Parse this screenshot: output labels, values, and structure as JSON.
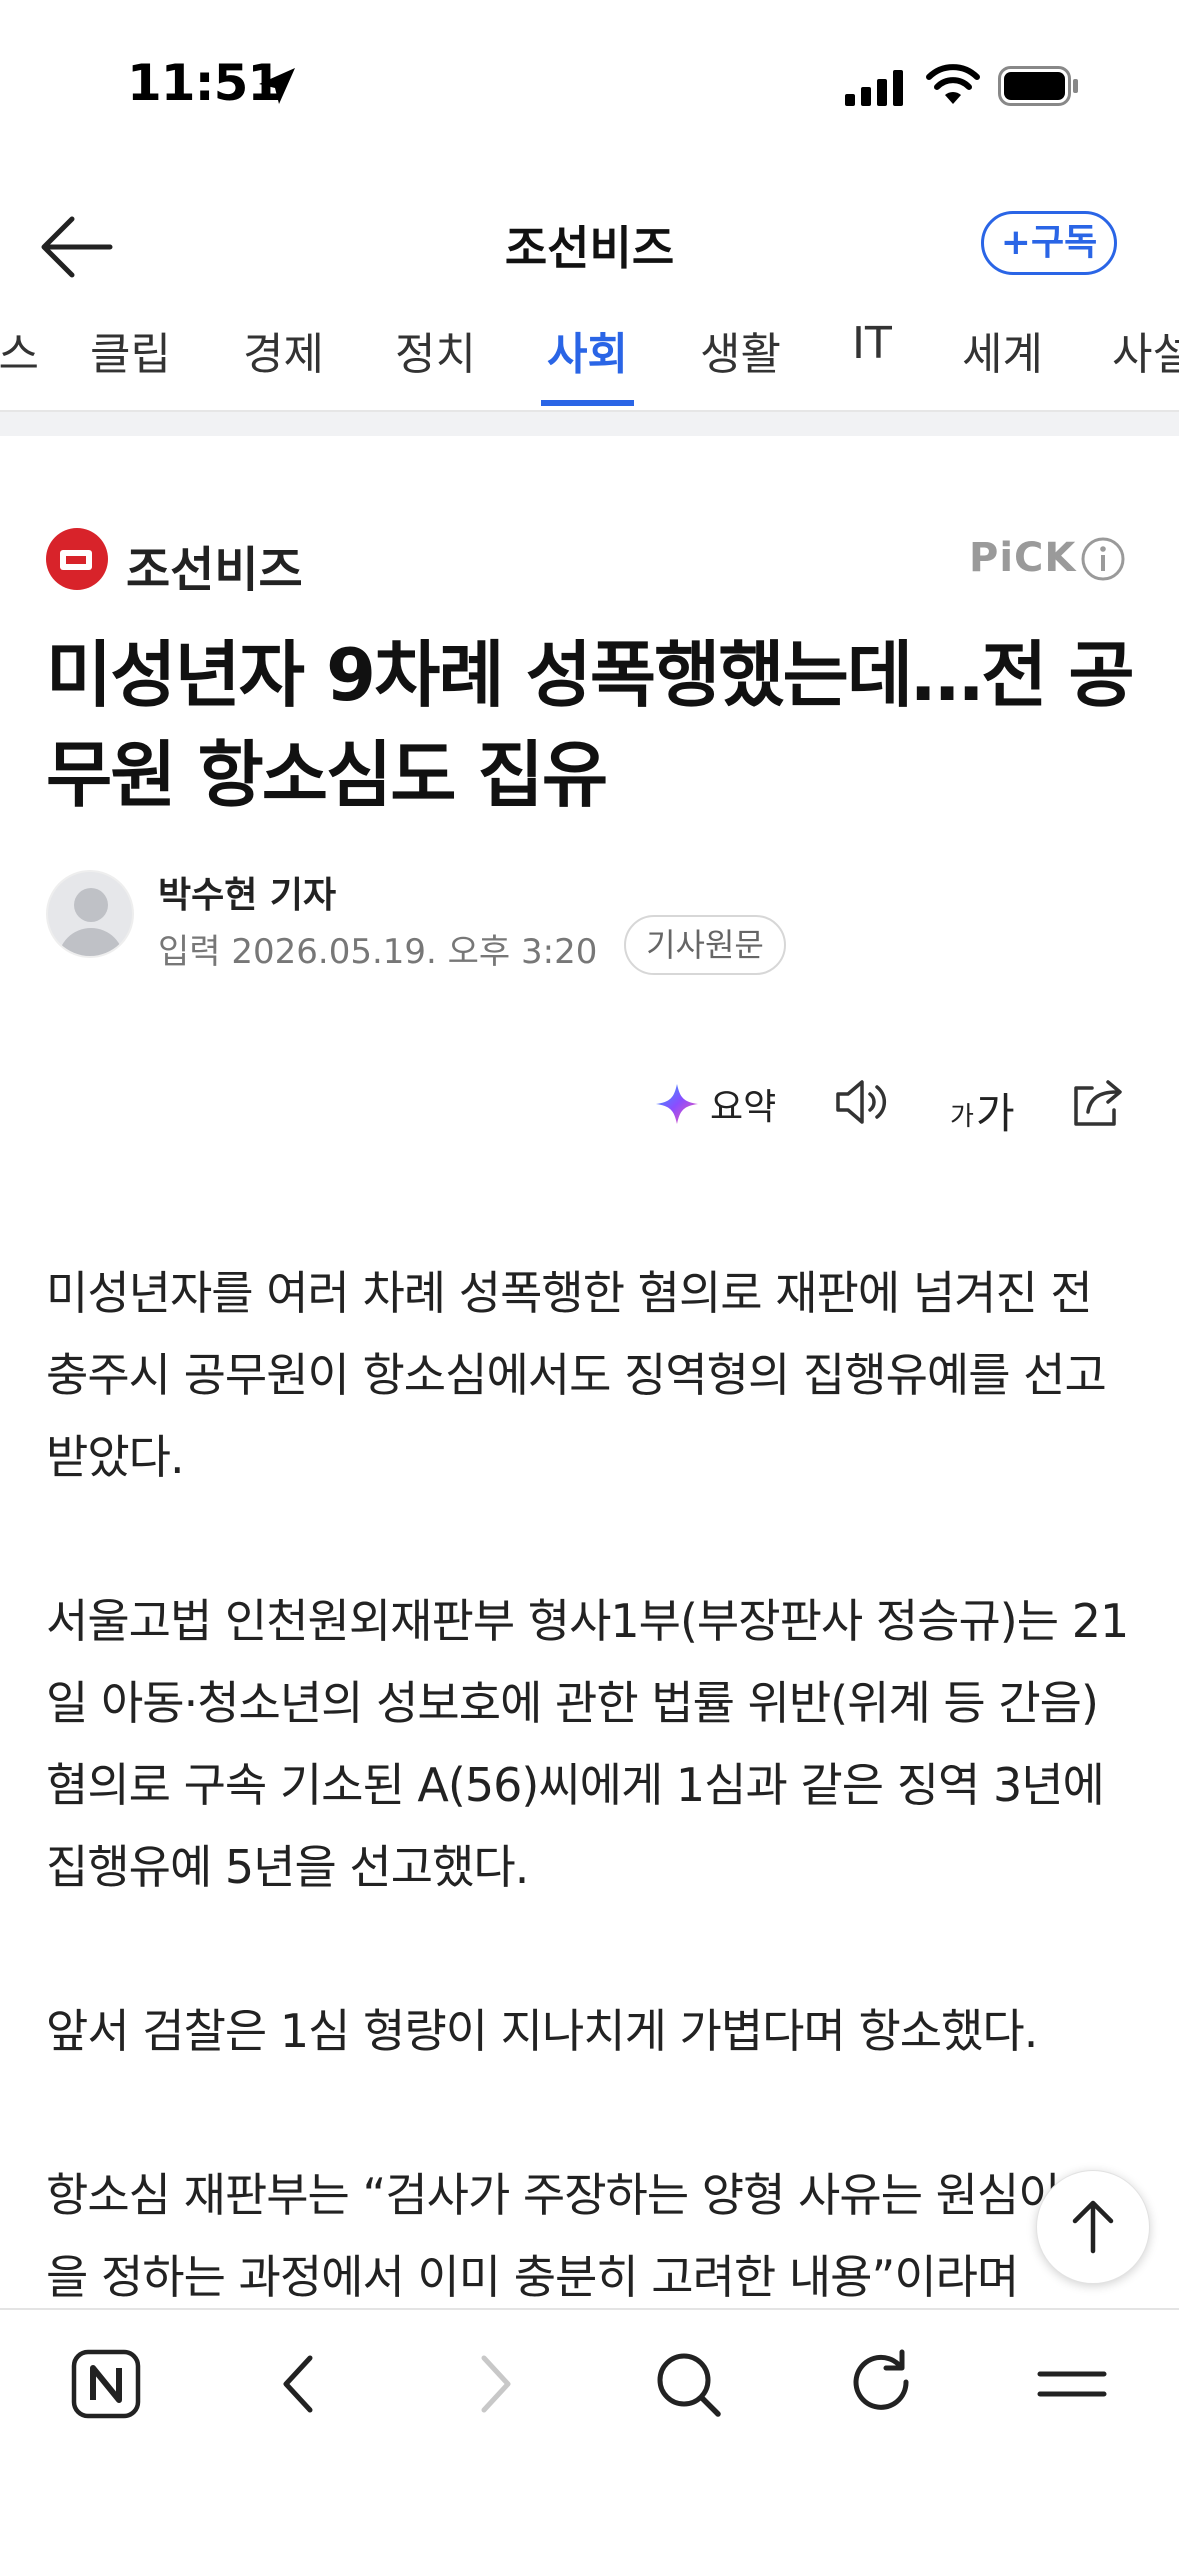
{
  "status_bar": {
    "time": "11:51"
  },
  "header": {
    "title": "조선비즈",
    "subscribe_label": "+구독"
  },
  "tabs": [
    {
      "label": "뉴스"
    },
    {
      "label": "클립"
    },
    {
      "label": "경제"
    },
    {
      "label": "정치"
    },
    {
      "label": "사회",
      "active": true
    },
    {
      "label": "생활"
    },
    {
      "label": "IT"
    },
    {
      "label": "세계"
    },
    {
      "label": "사설"
    }
  ],
  "press": {
    "name": "조선비즈",
    "badge": "PiCK"
  },
  "article": {
    "headline": "미성년자 9차례 성폭행했는데…전 공무원 항소심도 집유",
    "reporter": "박수현 기자",
    "published": "입력 2026.05.19. 오후 3:20",
    "original_label": "기사원문",
    "summary_label": "요약",
    "font_small": "가",
    "font_large": "가",
    "paragraphs": [
      "미성년자를 여러 차례 성폭행한 혐의로 재판에 넘겨진 전 충주시 공무원이 항소심에서도 징역형의 집행유예를 선고받았다.",
      "서울고법 인천원외재판부 형사1부(부장판사 정승규)는 21일 아동·청소년의 성보호에 관한 법률 위반(위계 등 간음) 혐의로 구속 기소된 A(56)씨에게 1심과 같은 징역 3년에 집행유예 5년을 선고했다.",
      "앞서 검찰은 1심 형량이 지나치게 가볍다며 항소했다.",
      "항소심 재판부는 “검사가 주장하는 양형 사유는 원심이 형을 정하는 과정에서 이미 충분히 고려한 내용”이라며"
    ]
  },
  "colors": {
    "accent": "#2a65e6",
    "brand_red": "#d8232a"
  },
  "bottom_bar": [
    "naver-icon",
    "back-icon",
    "forward-icon",
    "search-icon",
    "refresh-icon",
    "menu-icon"
  ]
}
